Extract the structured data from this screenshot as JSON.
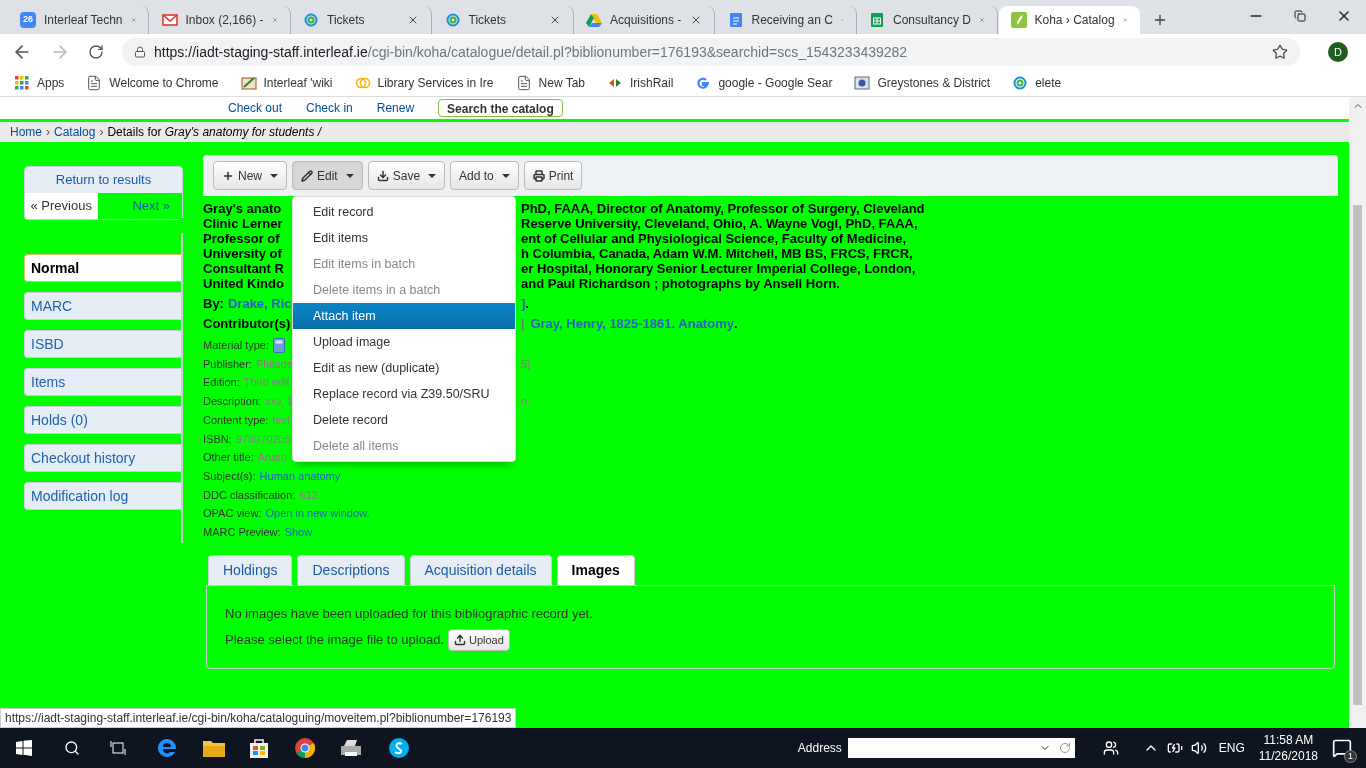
{
  "browser": {
    "tabs": [
      {
        "title": "Interleaf Techn",
        "badge": "26",
        "selected": false
      },
      {
        "title": "Inbox (2,166) -",
        "selected": false
      },
      {
        "title": "Tickets",
        "selected": false
      },
      {
        "title": "Tickets",
        "selected": false
      },
      {
        "title": "Acquisitions -",
        "selected": false
      },
      {
        "title": "Receiving an C",
        "selected": false
      },
      {
        "title": "Consultancy D",
        "selected": false
      },
      {
        "title": "Koha › Catalog",
        "selected": true
      }
    ],
    "url": {
      "host": "https://iadt-staging-staff.interleaf.ie",
      "path": "/cgi-bin/koha/catalogue/detail.pl?biblionumber=176193&searchid=scs_1543233439282"
    },
    "profile": "D",
    "bookmarks": [
      "Apps",
      "Welcome to Chrome",
      "Interleaf 'wiki",
      "Library Services in Ire",
      "New Tab",
      "IrishRail",
      "google - Google Sear",
      "Greystones & District",
      "elete"
    ]
  },
  "page": {
    "top_nav": [
      "Check out",
      "Check in",
      "Renew"
    ],
    "search_button": "Search the catalog",
    "breadcrumb": {
      "items": [
        "Home",
        "Catalog"
      ],
      "separator": "›",
      "current": "Details for *Gray's anatomy for students /*"
    },
    "sidebar": {
      "return": "Return to results",
      "previous": "« Previous",
      "next": "Next »",
      "views": [
        {
          "label": "Normal",
          "selected": true
        },
        {
          "label": "MARC",
          "selected": false
        },
        {
          "label": "ISBD",
          "selected": false
        },
        {
          "label": "Items",
          "selected": false
        },
        {
          "label": "Holds (0)",
          "selected": false
        },
        {
          "label": "Checkout history",
          "selected": false
        },
        {
          "label": "Modification log",
          "selected": false
        }
      ]
    },
    "toolbar": [
      {
        "label": "New",
        "caret": true,
        "pressed": false
      },
      {
        "label": "Edit",
        "caret": true,
        "pressed": true
      },
      {
        "label": "Save",
        "caret": true,
        "pressed": false
      },
      {
        "label": "Add to",
        "caret": true,
        "pressed": false
      },
      {
        "label": "Print",
        "caret": false,
        "pressed": false
      }
    ],
    "edit_menu": [
      {
        "label": "Edit record",
        "disabled": false,
        "selected": false
      },
      {
        "label": "Edit items",
        "disabled": false,
        "selected": false
      },
      {
        "label": "Edit items in batch",
        "disabled": true,
        "selected": false
      },
      {
        "label": "Delete items in a batch",
        "disabled": true,
        "selected": false
      },
      {
        "label": "Attach item",
        "disabled": false,
        "selected": true
      },
      {
        "label": "Upload image",
        "disabled": false,
        "selected": false
      },
      {
        "label": "Edit as new (duplicate)",
        "disabled": false,
        "selected": false
      },
      {
        "label": "Replace record via Z39.50/SRU",
        "disabled": false,
        "selected": false
      },
      {
        "label": "Delete record",
        "disabled": false,
        "selected": false
      },
      {
        "label": "Delete all items",
        "disabled": true,
        "selected": false
      }
    ],
    "title_lines": [
      {
        "left": "Gray's anato",
        "right": "PhD, FAAA, Director of Anatomy, Professor of Surgery, Cleveland"
      },
      {
        "left": "Clinic Lerner",
        "right": "Reserve University, Cleveland, Ohio, A. Wayne Vogl, PhD, FAAA,"
      },
      {
        "left": "Professor of",
        "right": "ent of Cellular and Physiological Science, Faculty of Medicine,"
      },
      {
        "left": "University of",
        "right": "h Columbia, Canada, Adam W.M. Mitchell, MB BS, FRCS, FRCR,"
      },
      {
        "left": "Consultant R",
        "right": "er Hospital, Honorary Senior Lecturer Imperial College, London,"
      },
      {
        "left": "United Kindo",
        "right": "and Paul Richardson ; photographs by Ansell Horn."
      }
    ],
    "by": {
      "label": "By:",
      "link": "Drake, Ric",
      "right_link": "]",
      "right_tail": "."
    },
    "contributors": {
      "label": "Contributor(s)",
      "separator": "|",
      "right_link": "Gray, Henry, 1825-1861. Anatomy",
      "right_tail": "."
    },
    "details": [
      {
        "label": "Material type:",
        "kind": "icon"
      },
      {
        "label": "Publisher:",
        "kind": "text",
        "value": "Philade",
        "right": "5]"
      },
      {
        "label": "Edition:",
        "kind": "text",
        "value": "Third edit"
      },
      {
        "label": "Description:",
        "kind": "text",
        "value": "xxv, 1",
        "right": "n."
      },
      {
        "label": "Content type:",
        "kind": "text",
        "value": "text"
      },
      {
        "label": "ISBN:",
        "kind": "text",
        "value": "978070205"
      },
      {
        "label": "Other title:",
        "kind": "text",
        "value": "Anato"
      },
      {
        "label": "Subject(s):",
        "kind": "link",
        "value": "Human anatomy"
      },
      {
        "label": "DDC classification:",
        "kind": "text",
        "value": "612"
      },
      {
        "label": "OPAC view:",
        "kind": "link",
        "value": "Open in new window."
      },
      {
        "label": "MARC Preview:",
        "kind": "link",
        "value": "Show"
      }
    ],
    "tabs": [
      {
        "label": "Holdings",
        "selected": false
      },
      {
        "label": "Descriptions",
        "selected": false
      },
      {
        "label": "Acquisition details",
        "selected": false
      },
      {
        "label": "Images",
        "selected": true
      }
    ],
    "images_panel": {
      "message": "No images have been uploaded for this bibliographic record yet.",
      "prompt": "Please select the image file to upload.",
      "button": "Upload"
    }
  },
  "status_url": "https://iadt-staging-staff.interleaf.ie/cgi-bin/koha/cataloguing/moveitem.pl?biblionumber=176193",
  "taskbar": {
    "address_label": "Address",
    "language": "ENG",
    "time": "11:58 AM",
    "date": "11/26/2018",
    "notifications": "1"
  }
}
